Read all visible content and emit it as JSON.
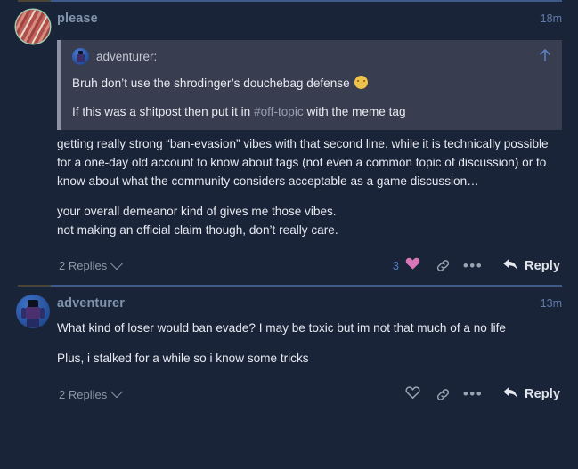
{
  "theme": {
    "page_bg": "#1a2438",
    "quote_bg": "#383d4f",
    "username_color": "#7f93ad",
    "timestamp_color": "#5e7ca8",
    "like_heart_color": "#d877b8",
    "like_count_color": "#4f7bc4",
    "divider_read_color": "#4a4536",
    "divider_color": "#3d5a8a"
  },
  "posts": [
    {
      "username": "please",
      "timestamp": "18m",
      "avatar_name": "avatar-meat-texture",
      "quote": {
        "author": "adventurer:",
        "avatar_name": "quote-avatar-adventurer",
        "expand_icon": "arrow-up-icon",
        "lines": [
          {
            "before": "Bruh don’t use the shrodinger’s douchebag defense ",
            "hashtag": "",
            "after": "",
            "emoji": "neutral-face-emoji"
          },
          {
            "before": "If this was a shitpost then put it in ",
            "hashtag": "#off-topic",
            "after": " with the meme tag",
            "emoji": ""
          }
        ]
      },
      "paragraphs": [
        "getting really strong “ban-evasion” vibes with that second line. while it is technically possible for a one-day old account to know about tags (not even a common topic of discussion) or to know about what the community considers acceptable as a game discussion…"
      ],
      "paragraph_group": [
        "your overall demeanor kind of gives me those vibes.",
        "not making an official claim though, don’t really care."
      ],
      "actions": {
        "replies_label": "2 Replies",
        "replies_chevron": "chevron-down-icon",
        "like_count": "3",
        "like_icon": "heart-filled-icon",
        "link_icon": "link-icon",
        "more_icon": "ellipsis-icon",
        "reply_icon": "reply-arrow-icon",
        "reply_label": "Reply"
      }
    },
    {
      "username": "adventurer",
      "timestamp": "13m",
      "avatar_name": "avatar-adventurer-character",
      "quote": null,
      "paragraphs": [
        "What kind of loser would ban evade? I may be toxic but im not that much of a no life",
        "Plus, i stalked for a while so i know some tricks"
      ],
      "actions": {
        "replies_label": "2 Replies",
        "replies_chevron": "chevron-down-icon",
        "like_count": "",
        "like_icon": "heart-outline-icon",
        "link_icon": "link-icon",
        "more_icon": "ellipsis-icon",
        "reply_icon": "reply-arrow-icon",
        "reply_label": "Reply"
      }
    }
  ]
}
